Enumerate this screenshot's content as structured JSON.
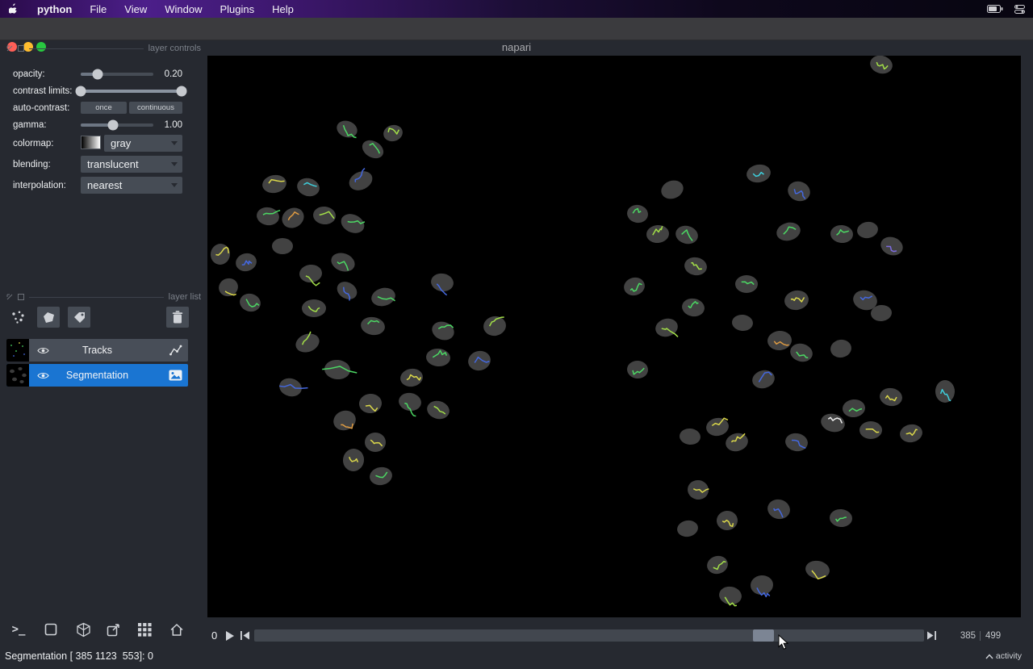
{
  "menubar": {
    "app_name": "python",
    "items": [
      "File",
      "View",
      "Window",
      "Plugins",
      "Help"
    ]
  },
  "titlebar": {
    "title": "napari"
  },
  "layer_controls": {
    "header": "layer controls",
    "opacity": {
      "label": "opacity:",
      "value": "0.20"
    },
    "contrast": {
      "label": "contrast limits:"
    },
    "autocontrast": {
      "label": "auto-contrast:",
      "once": "once",
      "continuous": "continuous"
    },
    "gamma": {
      "label": "gamma:",
      "value": "1.00"
    },
    "colormap": {
      "label": "colormap:",
      "value": "gray"
    },
    "blending": {
      "label": "blending:",
      "value": "translucent"
    },
    "interpolation": {
      "label": "interpolation:",
      "value": "nearest"
    }
  },
  "sliders": {
    "opacity_pct": 23,
    "gamma_pct": 44,
    "contrast_low_pct": 0,
    "contrast_high_pct": 100
  },
  "layer_list": {
    "header": "layer list",
    "layers": [
      {
        "name": "Tracks",
        "selected": false,
        "type": "tracks"
      },
      {
        "name": "Segmentation",
        "selected": true,
        "type": "image"
      }
    ]
  },
  "dims": {
    "axis_label": "0",
    "current": "385",
    "total": "499",
    "position_pct": 76
  },
  "statusbar": {
    "left": "Segmentation [ 385 1123  553]: 0",
    "activity_label": "activity"
  },
  "colors": {
    "selection": "#1a75d2",
    "panel_bg": "#262930",
    "control_bg": "#464c55",
    "canvas_bg": "#000000"
  },
  "canvas": {
    "blob_fill": "#424242",
    "track_colors": [
      "#4cd964",
      "#a3e048",
      "#3ecfdc",
      "#4468e0",
      "#dbd84a",
      "#e09c42",
      "#f0f0f0",
      "#7e6ce0"
    ],
    "blobs": [
      [
        173,
        91,
        13,
        10,
        20,
        0
      ],
      [
        230,
        96,
        12,
        10,
        -15,
        1
      ],
      [
        205,
        116,
        14,
        10,
        30,
        0
      ],
      [
        83,
        159,
        15,
        11,
        -10,
        4
      ],
      [
        125,
        163,
        14,
        11,
        15,
        2
      ],
      [
        190,
        155,
        15,
        11,
        -25,
        3
      ],
      [
        75,
        199,
        14,
        11,
        10,
        0
      ],
      [
        106,
        201,
        14,
        12,
        -30,
        5
      ],
      [
        145,
        198,
        14,
        11,
        5,
        1
      ],
      [
        180,
        208,
        15,
        11,
        25,
        0
      ],
      [
        93,
        236,
        13,
        10,
        0,
        -1
      ],
      [
        16,
        246,
        12,
        13,
        10,
        4
      ],
      [
        48,
        256,
        13,
        11,
        -15,
        3
      ],
      [
        168,
        256,
        15,
        11,
        20,
        0
      ],
      [
        128,
        270,
        14,
        11,
        -5,
        1
      ],
      [
        291,
        281,
        14,
        11,
        10,
        3
      ],
      [
        26,
        287,
        12,
        11,
        -20,
        4
      ],
      [
        53,
        306,
        13,
        11,
        15,
        0
      ],
      [
        132,
        313,
        15,
        11,
        0,
        1
      ],
      [
        218,
        299,
        15,
        11,
        -15,
        0
      ],
      [
        173,
        291,
        13,
        10,
        30,
        3
      ],
      [
        205,
        335,
        15,
        11,
        10,
        0
      ],
      [
        356,
        335,
        14,
        12,
        -10,
        1
      ],
      [
        292,
        341,
        14,
        11,
        20,
        0
      ],
      [
        124,
        356,
        15,
        11,
        -20,
        1
      ],
      [
        286,
        374,
        15,
        11,
        5,
        0
      ],
      [
        337,
        378,
        14,
        12,
        -15,
        3
      ],
      [
        161,
        389,
        16,
        12,
        5,
        0,
        2.6
      ],
      [
        253,
        399,
        14,
        11,
        -10,
        4
      ],
      [
        103,
        411,
        14,
        11,
        15,
        3,
        2.2
      ],
      [
        202,
        431,
        14,
        12,
        -5,
        4
      ],
      [
        251,
        429,
        14,
        11,
        10,
        0
      ],
      [
        170,
        452,
        14,
        12,
        -20,
        5
      ],
      [
        286,
        439,
        14,
        11,
        15,
        1
      ],
      [
        208,
        479,
        13,
        12,
        0,
        4
      ],
      [
        181,
        501,
        13,
        14,
        10,
        4
      ],
      [
        215,
        521,
        14,
        11,
        -10,
        0
      ],
      [
        835,
        11,
        14,
        11,
        15,
        1
      ],
      [
        683,
        146,
        15,
        11,
        -10,
        2
      ],
      [
        733,
        168,
        14,
        12,
        20,
        3
      ],
      [
        576,
        166,
        14,
        11,
        -20,
        -1
      ],
      [
        533,
        196,
        13,
        11,
        10,
        0
      ],
      [
        558,
        221,
        14,
        11,
        -5,
        1
      ],
      [
        594,
        222,
        14,
        11,
        15,
        0
      ],
      [
        720,
        218,
        15,
        11,
        -15,
        0
      ],
      [
        786,
        221,
        14,
        11,
        5,
        0
      ],
      [
        818,
        216,
        13,
        10,
        -10,
        -1
      ],
      [
        848,
        236,
        14,
        11,
        20,
        7
      ],
      [
        529,
        286,
        13,
        11,
        -15,
        0
      ],
      [
        605,
        261,
        14,
        11,
        10,
        1
      ],
      [
        668,
        283,
        14,
        11,
        0,
        0
      ],
      [
        730,
        303,
        15,
        12,
        -10,
        4
      ],
      [
        815,
        303,
        15,
        12,
        15,
        3
      ],
      [
        835,
        319,
        13,
        10,
        -5,
        -1
      ],
      [
        602,
        312,
        14,
        11,
        10,
        0
      ],
      [
        569,
        337,
        14,
        11,
        -15,
        1
      ],
      [
        663,
        331,
        13,
        10,
        5,
        -1
      ],
      [
        709,
        353,
        15,
        12,
        -5,
        5
      ],
      [
        736,
        368,
        14,
        11,
        15,
        0
      ],
      [
        785,
        363,
        13,
        11,
        -10,
        -1
      ],
      [
        533,
        389,
        13,
        11,
        5,
        0
      ],
      [
        689,
        401,
        14,
        11,
        -15,
        3
      ],
      [
        914,
        416,
        12,
        14,
        0,
        2
      ],
      [
        847,
        423,
        14,
        11,
        10,
        4
      ],
      [
        801,
        437,
        14,
        11,
        -5,
        0
      ],
      [
        775,
        455,
        15,
        11,
        15,
        6
      ],
      [
        632,
        460,
        14,
        11,
        -10,
        4
      ],
      [
        598,
        472,
        13,
        10,
        5,
        -1
      ],
      [
        656,
        479,
        14,
        11,
        -15,
        4
      ],
      [
        730,
        479,
        14,
        11,
        10,
        3
      ],
      [
        822,
        464,
        14,
        11,
        0,
        4
      ],
      [
        872,
        468,
        14,
        11,
        -10,
        4
      ],
      [
        608,
        538,
        13,
        12,
        10,
        4
      ],
      [
        644,
        576,
        13,
        12,
        -5,
        4
      ],
      [
        708,
        562,
        14,
        12,
        15,
        3
      ],
      [
        595,
        586,
        13,
        10,
        -10,
        -1
      ],
      [
        785,
        573,
        14,
        11,
        5,
        0
      ],
      [
        632,
        631,
        13,
        11,
        -15,
        1
      ],
      [
        756,
        637,
        15,
        11,
        10,
        4
      ],
      [
        687,
        656,
        14,
        12,
        -5,
        3
      ],
      [
        648,
        669,
        14,
        11,
        10,
        1
      ]
    ]
  }
}
